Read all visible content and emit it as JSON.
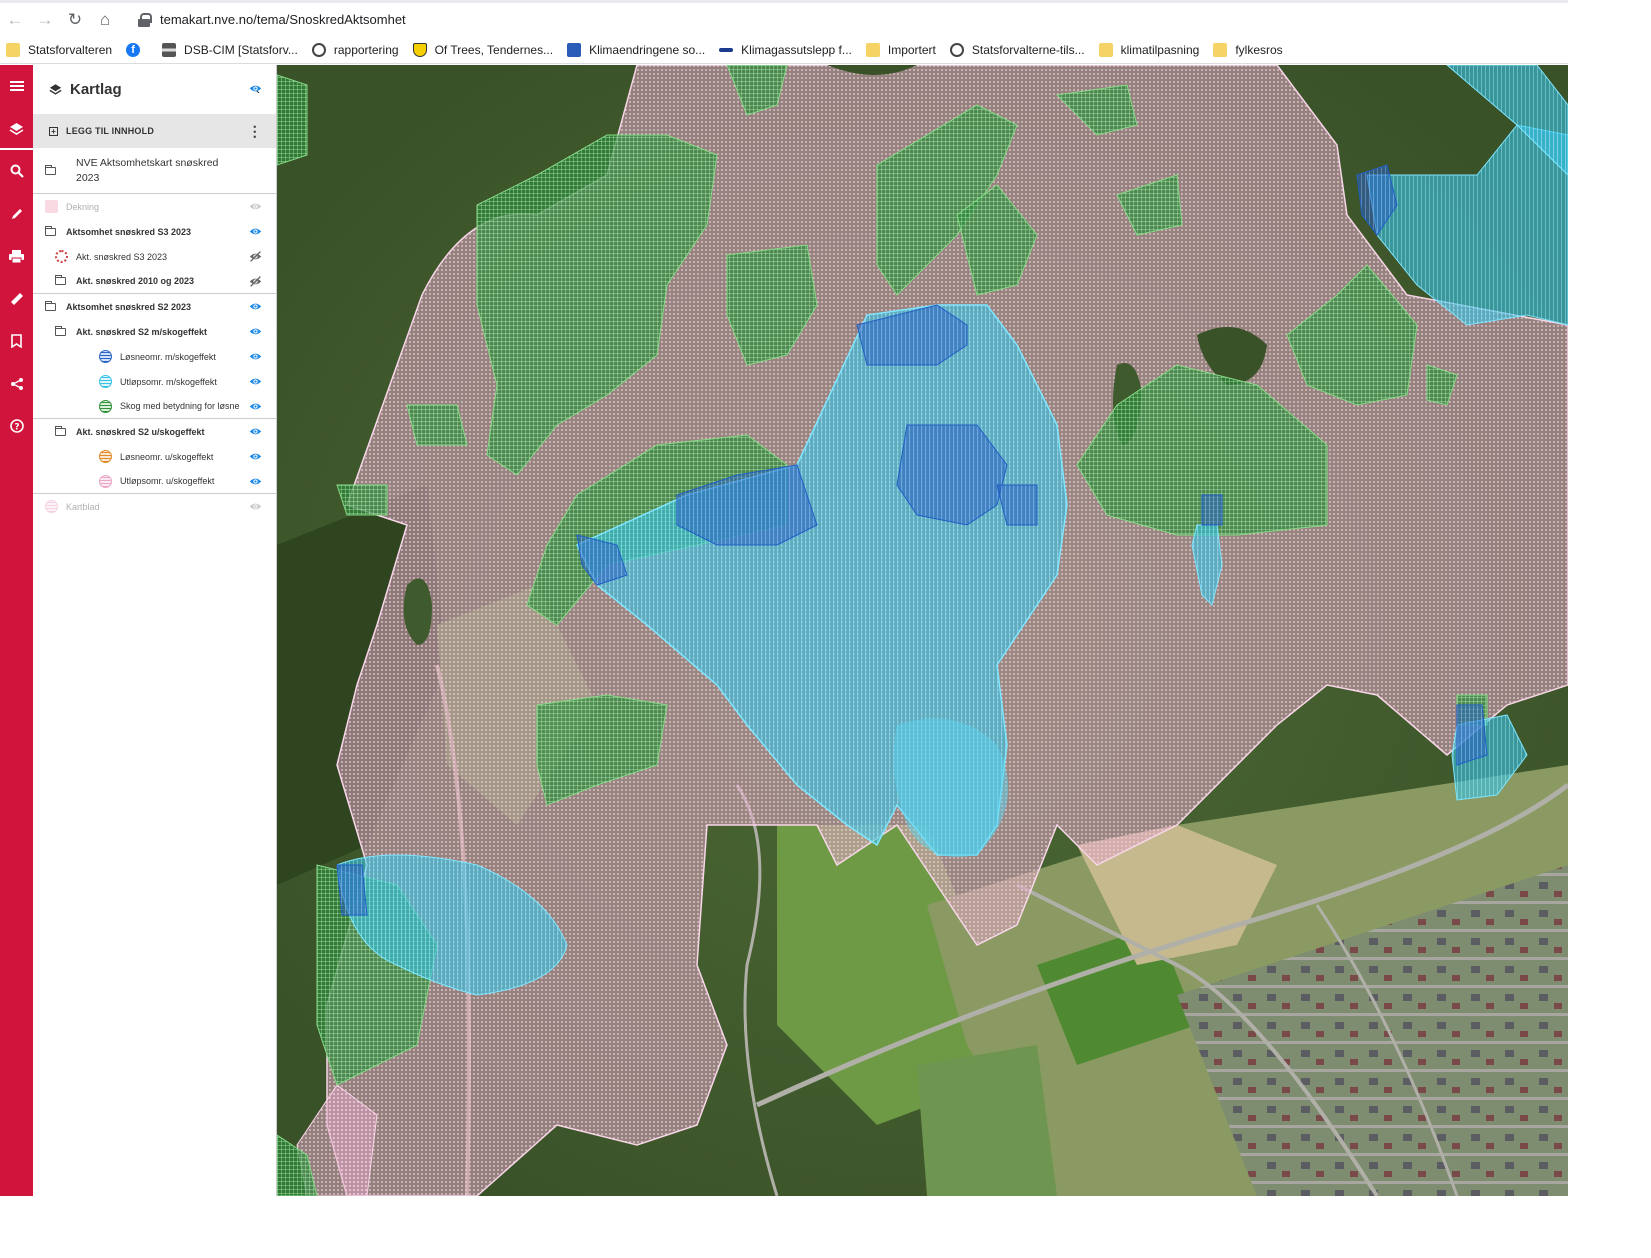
{
  "browser": {
    "url": "temakart.nve.no/tema/SnoskredAktsomhet",
    "bookmarks": [
      {
        "label": "Statsforvalteren",
        "icon": "folder-icon"
      },
      {
        "label": "",
        "icon": "facebook-icon"
      },
      {
        "label": "DSB-CIM [Statsforv...",
        "icon": "dsb-icon"
      },
      {
        "label": "rapportering",
        "icon": "globe-icon"
      },
      {
        "label": "Of Trees, Tendernes...",
        "icon": "shield-icon"
      },
      {
        "label": "Klimaendringene so...",
        "icon": "nrk-icon"
      },
      {
        "label": "Klimagassutslepp f...",
        "icon": "dash-icon"
      },
      {
        "label": "Importert",
        "icon": "folder-icon"
      },
      {
        "label": "Statsforvalterne-tils...",
        "icon": "globe-icon"
      },
      {
        "label": "klimatilpasning",
        "icon": "folder-icon"
      },
      {
        "label": "fylkesros",
        "icon": "folder-icon"
      }
    ]
  },
  "panel": {
    "title": "Kartlag",
    "add_content": "LEGG TIL INNHOLD",
    "group_title": "NVE Aktsomhetskart snøskred 2023",
    "layers": [
      {
        "label": "Dekning",
        "indent": 0,
        "icon": "pink-square-icon",
        "bold": false,
        "dim": true,
        "eye": "visible",
        "sep": false
      },
      {
        "label": "Aktsomhet snøskred S3 2023",
        "indent": 0,
        "icon": "folder-icon",
        "bold": true,
        "dim": false,
        "eye": "visible",
        "sep": false
      },
      {
        "label": "Akt. snøskred S3 2023",
        "indent": 1,
        "icon": "red-hatch-icon",
        "bold": false,
        "dim": false,
        "eye": "hidden",
        "sep": false
      },
      {
        "label": "Akt. snøskred 2010 og 2023",
        "indent": 1,
        "icon": "folder-icon",
        "bold": true,
        "dim": false,
        "eye": "hidden",
        "sep": true
      },
      {
        "label": "Aktsomhet snøskred S2 2023",
        "indent": 0,
        "icon": "folder-icon",
        "bold": true,
        "dim": false,
        "eye": "visible",
        "sep": false
      },
      {
        "label": "Akt. snøskred S2 m/skogeffekt",
        "indent": 1,
        "icon": "folder-icon",
        "bold": true,
        "dim": false,
        "eye": "visible",
        "sep": false
      },
      {
        "label": "Løsneomr. m/skogeffekt",
        "indent": 2,
        "icon": "blue-grid-icon",
        "bold": false,
        "dim": false,
        "eye": "visible",
        "sep": false
      },
      {
        "label": "Utløpsomr. m/skogeffekt",
        "indent": 2,
        "icon": "cyan-grid-icon",
        "bold": false,
        "dim": false,
        "eye": "visible",
        "sep": false
      },
      {
        "label": "Skog med betydning for løsne",
        "indent": 2,
        "icon": "green-grid-icon",
        "bold": false,
        "dim": false,
        "eye": "visible",
        "sep": true
      },
      {
        "label": "Akt. snøskred S2 u/skogeffekt",
        "indent": 1,
        "icon": "folder-icon",
        "bold": true,
        "dim": false,
        "eye": "visible",
        "sep": false
      },
      {
        "label": "Løsneomr. u/skogeffekt",
        "indent": 2,
        "icon": "orange-grid-icon",
        "bold": false,
        "dim": false,
        "eye": "visible",
        "sep": false
      },
      {
        "label": "Utløpsomr. u/skogeffekt",
        "indent": 2,
        "icon": "pink-grid-icon",
        "bold": false,
        "dim": false,
        "eye": "visible",
        "sep": true
      },
      {
        "label": "Kartblad",
        "indent": 0,
        "icon": "pink-grid-icon",
        "bold": false,
        "dim": true,
        "eye": "visible",
        "sep": false
      }
    ]
  },
  "colors": {
    "rail": "#d0143c",
    "eye_active": "#1e88e5",
    "runout_pink": "#e8aacb",
    "forest_green": "#2f8f3a",
    "release_blue": "#2b7fd8",
    "runout_cyan": "#37c6e6"
  }
}
